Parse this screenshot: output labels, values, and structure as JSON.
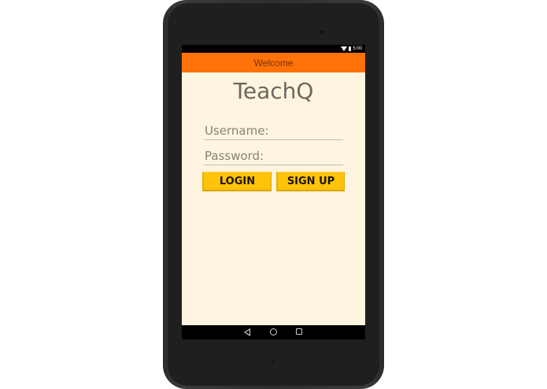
{
  "status_bar": {
    "time": "5:00",
    "icons": [
      "wifi-icon",
      "battery-icon"
    ]
  },
  "action_bar": {
    "title": "Welcome",
    "color": "#ff7209"
  },
  "app": {
    "title": "TeachQ"
  },
  "form": {
    "username_placeholder": "Username:",
    "password_placeholder": "Password:",
    "login_label": "LOGIN",
    "signup_label": "SIGN UP",
    "button_color": "#ffc30a"
  },
  "nav_bar": {
    "icons": [
      "back-icon",
      "home-icon",
      "recent-apps-icon"
    ]
  },
  "colors": {
    "screen_background": "#fdf5df"
  }
}
